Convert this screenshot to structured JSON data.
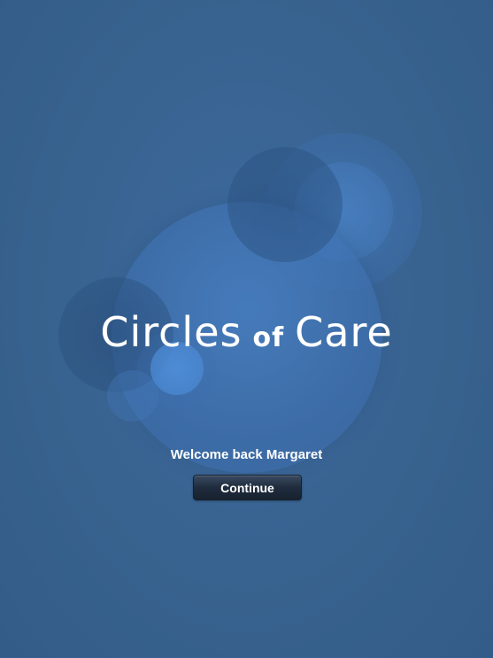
{
  "app": {
    "title_word_1": "Circles",
    "title_word_2": "of",
    "title_word_3": "Care"
  },
  "welcome": {
    "message": "Welcome back Margaret"
  },
  "actions": {
    "continue_label": "Continue"
  },
  "colors": {
    "background": "#38628f",
    "button": "#1f2c3d",
    "text": "#ffffff"
  }
}
